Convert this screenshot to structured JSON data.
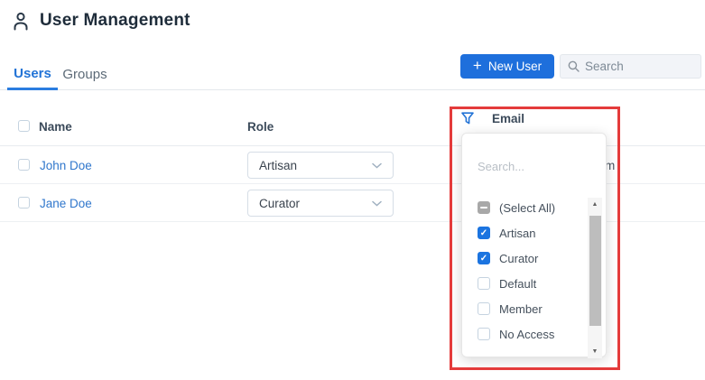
{
  "page": {
    "title": "User Management"
  },
  "tabs": [
    {
      "label": "Users",
      "active": true
    },
    {
      "label": "Groups",
      "active": false
    }
  ],
  "toolbar": {
    "plus_icon": "+",
    "new_user_label": "New User",
    "search_placeholder": "Search"
  },
  "table": {
    "columns": [
      {
        "label": "Name"
      },
      {
        "label": "Role"
      },
      {
        "label": "Email"
      }
    ],
    "rows": [
      {
        "name": "John Doe",
        "role": "Artisan",
        "email_visible_fragment": "m"
      },
      {
        "name": "Jane Doe",
        "role": "Curator"
      }
    ]
  },
  "filter_popup": {
    "column": "Email",
    "search_placeholder": "Search...",
    "options": [
      {
        "label": "(Select All)",
        "state": "indeterminate"
      },
      {
        "label": "Artisan",
        "state": "checked"
      },
      {
        "label": "Curator",
        "state": "checked"
      },
      {
        "label": "Default",
        "state": "unchecked"
      },
      {
        "label": "Member",
        "state": "unchecked"
      },
      {
        "label": "No Access",
        "state": "unchecked"
      }
    ],
    "scrollbar": {
      "up_icon": "▲",
      "down_icon": "▼"
    }
  },
  "colors": {
    "accent_blue": "#1e6fdc",
    "link_blue": "#3077cc",
    "checked_blue": "#1b74e0",
    "annotation_red": "#e43b3b",
    "title_text": "#1e2c3a"
  }
}
